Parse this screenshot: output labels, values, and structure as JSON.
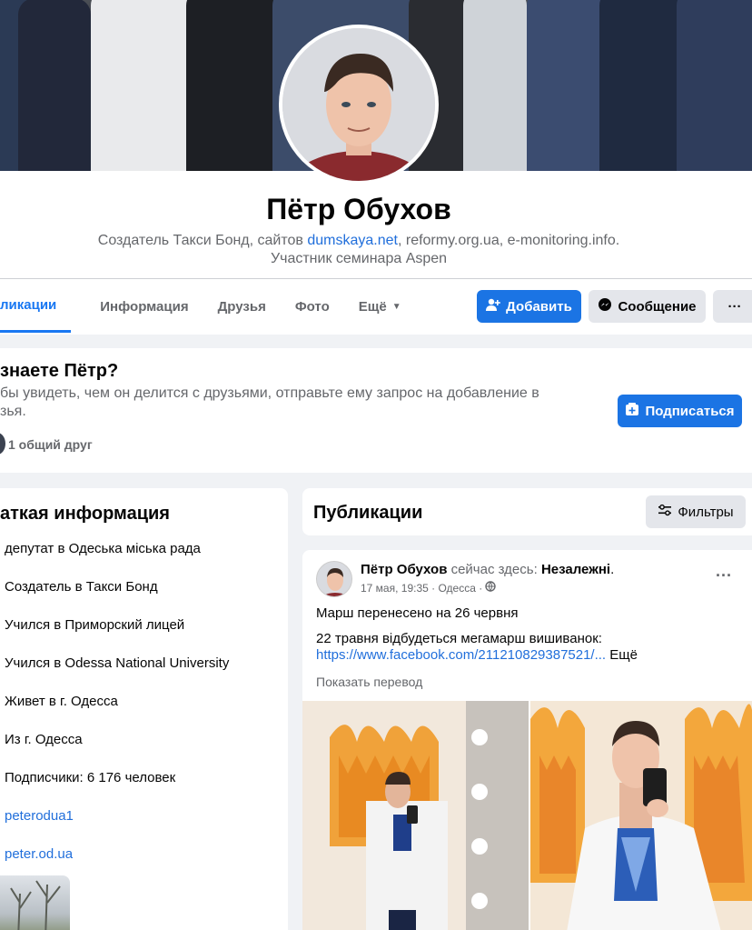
{
  "profile": {
    "name": "Пётр Обухов",
    "bio_line1_prefix": "Создатель Такси Бонд, сайтов ",
    "bio_link": "dumskaya.net",
    "bio_line1_suffix": ", reformy.org.ua, e-monitoring.info.",
    "bio_line2": "Участник семинара Aspen"
  },
  "tabs": [
    {
      "label": "ликации",
      "active": true
    },
    {
      "label": "Информация"
    },
    {
      "label": "Друзья"
    },
    {
      "label": "Фото"
    },
    {
      "label": "Ещё"
    }
  ],
  "actions": {
    "add_label": "Добавить",
    "message_label": "Сообщение",
    "more_label": "···"
  },
  "know": {
    "title": "знаете Пётр?",
    "text_line1": "бы увидеть, чем он делится с друзьями, отправьте ему запрос на добавление в",
    "text_line2": "зья.",
    "mutual": "1 общий друг",
    "subscribe_label": "Подписаться"
  },
  "intro": {
    "title": "аткая информация",
    "items": [
      {
        "prefix": "депутат в ",
        "value": "Одеська міська рада"
      },
      {
        "prefix": "Создатель в ",
        "value": "Такси Бонд"
      },
      {
        "prefix": "Учился в ",
        "value": "Приморский лицей"
      },
      {
        "prefix": "Учился в ",
        "value": "Odessa National University"
      },
      {
        "prefix": "Живет в г. ",
        "value": "Одесса"
      },
      {
        "prefix": "Из г. ",
        "value": "Одесса"
      },
      {
        "prefix": "Подписчики: ",
        "value": "6 176 человек"
      },
      {
        "link": "peterodua1"
      },
      {
        "link": "peter.od.ua"
      }
    ]
  },
  "posts_header": {
    "title": "Публикации",
    "filters_label": "Фильтры"
  },
  "post": {
    "author": "Пётр Обухов",
    "status_prefix": " сейчас здесь: ",
    "place": "Незалежні",
    "status_suffix": ".",
    "date": "17 мая, 19:35 · Одесса ·",
    "more": "···",
    "line1": "Марш перенесено на 26 червня",
    "line2": "22 травня відбудеться мегамарш вишиванок:",
    "link": "https://www.facebook.com/211210829387521/...",
    "more_text": " Ещё",
    "translate": "Показать перевод"
  },
  "colors": {
    "accent": "#1b74e4",
    "link": "#216fdb",
    "background": "#f0f2f5"
  }
}
